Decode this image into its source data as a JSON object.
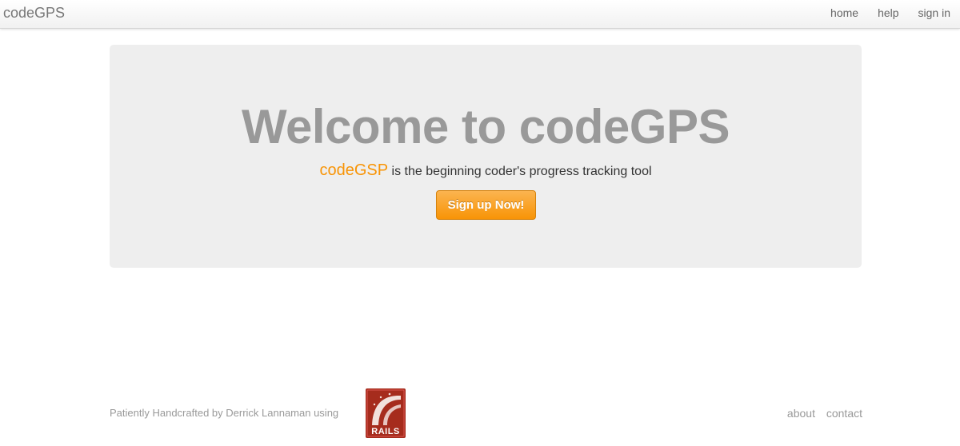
{
  "navbar": {
    "brand": "codeGPS",
    "links": [
      "home",
      "help",
      "sign in"
    ]
  },
  "hero": {
    "title": "Welcome to codeGPS",
    "tagline_brand": "codeGSP",
    "tagline_rest": " is the beginning coder's progress tracking tool",
    "signup_label": "Sign up Now!"
  },
  "footer": {
    "credit": "Patiently Handcrafted by Derrick Lannaman using",
    "rails_logo_text": "RAILS",
    "links": [
      "about",
      "contact"
    ]
  },
  "colors": {
    "accent": "#f89406",
    "hero_bg": "#eeeeee",
    "rails_red": "#a62c1d"
  }
}
